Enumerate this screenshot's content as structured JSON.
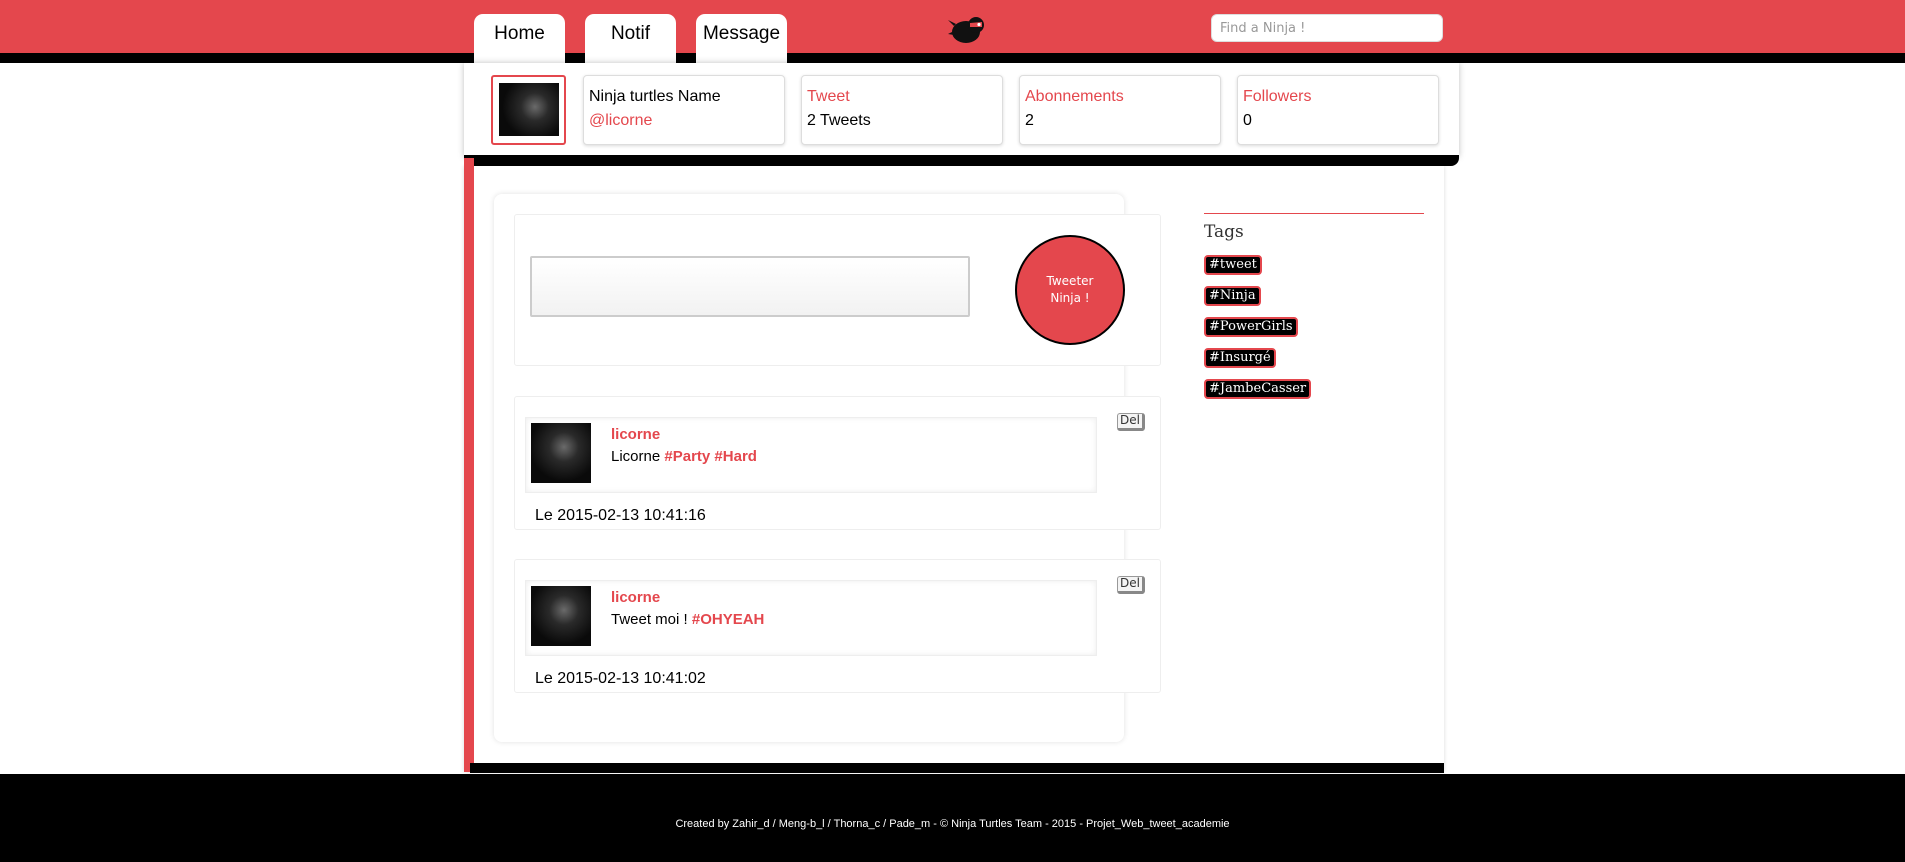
{
  "nav": {
    "tabs": [
      {
        "label": "Home"
      },
      {
        "label": "Notif"
      },
      {
        "label": "Message"
      }
    ],
    "logo_icon": "ninja-bird-icon",
    "search_placeholder": "Find a Ninja !"
  },
  "profile": {
    "name": "Ninja turtles Name",
    "handle": "@licorne",
    "stats": {
      "tweet": {
        "label": "Tweet",
        "value": "2 Tweets"
      },
      "abonnements": {
        "label": "Abonnements",
        "value": "2"
      },
      "followers": {
        "label": "Followers",
        "value": "0"
      }
    }
  },
  "compose": {
    "button_label": "Tweeter Ninja !"
  },
  "tweets": [
    {
      "user": "licorne",
      "text": "Licorne ",
      "tags": [
        "#Party",
        "#Hard"
      ],
      "date": "Le 2015-02-13 10:41:16",
      "del_label": "Del"
    },
    {
      "user": "licorne",
      "text": "Tweet moi ! ",
      "tags": [
        "#OHYEAH"
      ],
      "date": "Le 2015-02-13 10:41:02",
      "del_label": "Del"
    }
  ],
  "sidebar": {
    "title": "Tags",
    "tags": [
      "#tweet",
      "#Ninja",
      "#PowerGirls",
      "#Insurgé",
      "#JambeCasser"
    ]
  },
  "footer": {
    "text": "Created by Zahir_d / Meng-b_l / Thorna_c / Pade_m - © Ninja Turtles Team - 2015 - Projet_Web_tweet_academie"
  },
  "colors": {
    "accent": "#e4474d",
    "dark": "#000000"
  }
}
